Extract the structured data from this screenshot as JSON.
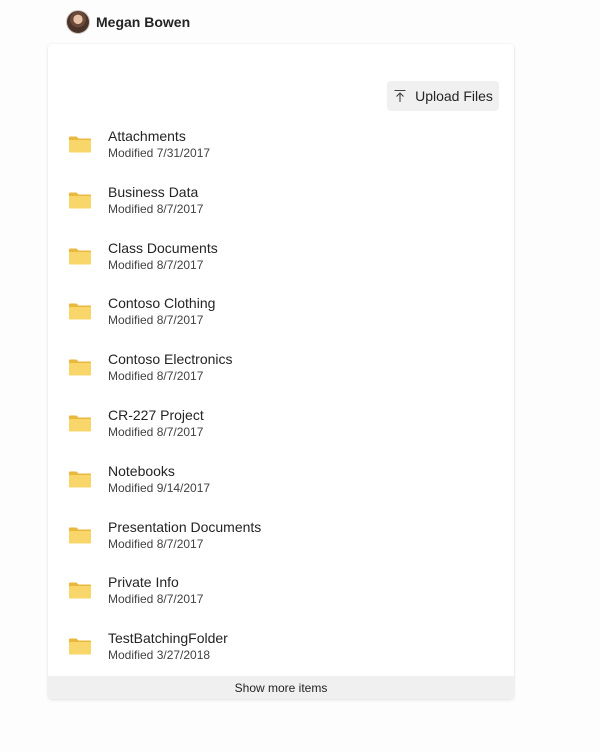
{
  "user": {
    "name": "Megan Bowen"
  },
  "toolbar": {
    "upload_label": "Upload Files",
    "upload_icon": "arrow-up-to-line-icon"
  },
  "items": [
    {
      "name": "Attachments",
      "modified": "Modified 7/31/2017"
    },
    {
      "name": "Business Data",
      "modified": "Modified 8/7/2017"
    },
    {
      "name": "Class Documents",
      "modified": "Modified 8/7/2017"
    },
    {
      "name": "Contoso Clothing",
      "modified": "Modified 8/7/2017"
    },
    {
      "name": "Contoso Electronics",
      "modified": "Modified 8/7/2017"
    },
    {
      "name": "CR-227 Project",
      "modified": "Modified 8/7/2017"
    },
    {
      "name": "Notebooks",
      "modified": "Modified 9/14/2017"
    },
    {
      "name": "Presentation Documents",
      "modified": "Modified 8/7/2017"
    },
    {
      "name": "Private Info",
      "modified": "Modified 8/7/2017"
    },
    {
      "name": "TestBatchingFolder",
      "modified": "Modified 3/27/2018"
    }
  ],
  "footer": {
    "show_more_label": "Show more items"
  },
  "colors": {
    "folder": "#f9d66a",
    "folder_tab": "#e9b93f",
    "button_bg": "#f0f0f0"
  }
}
